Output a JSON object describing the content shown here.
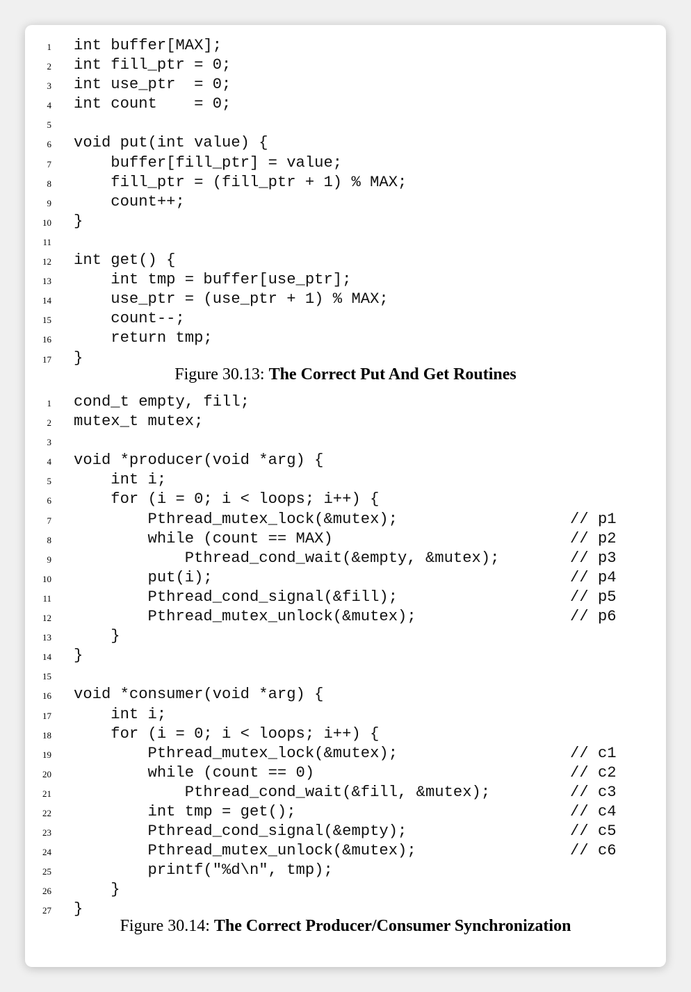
{
  "figure1": {
    "lines": [
      {
        "n": "1",
        "code": "int buffer[MAX];",
        "comment": ""
      },
      {
        "n": "2",
        "code": "int fill_ptr = 0;",
        "comment": ""
      },
      {
        "n": "3",
        "code": "int use_ptr  = 0;",
        "comment": ""
      },
      {
        "n": "4",
        "code": "int count    = 0;",
        "comment": ""
      },
      {
        "n": "5",
        "code": "",
        "comment": ""
      },
      {
        "n": "6",
        "code": "void put(int value) {",
        "comment": ""
      },
      {
        "n": "7",
        "code": "    buffer[fill_ptr] = value;",
        "comment": ""
      },
      {
        "n": "8",
        "code": "    fill_ptr = (fill_ptr + 1) % MAX;",
        "comment": ""
      },
      {
        "n": "9",
        "code": "    count++;",
        "comment": ""
      },
      {
        "n": "10",
        "code": "}",
        "comment": ""
      },
      {
        "n": "11",
        "code": "",
        "comment": ""
      },
      {
        "n": "12",
        "code": "int get() {",
        "comment": ""
      },
      {
        "n": "13",
        "code": "    int tmp = buffer[use_ptr];",
        "comment": ""
      },
      {
        "n": "14",
        "code": "    use_ptr = (use_ptr + 1) % MAX;",
        "comment": ""
      },
      {
        "n": "15",
        "code": "    count--;",
        "comment": ""
      },
      {
        "n": "16",
        "code": "    return tmp;",
        "comment": ""
      },
      {
        "n": "17",
        "code": "}",
        "comment": ""
      }
    ],
    "caption_number": "Figure 30.13:",
    "caption_title": "The Correct Put And Get Routines"
  },
  "figure2": {
    "lines": [
      {
        "n": "1",
        "code": "cond_t empty, fill;",
        "comment": ""
      },
      {
        "n": "2",
        "code": "mutex_t mutex;",
        "comment": ""
      },
      {
        "n": "3",
        "code": "",
        "comment": ""
      },
      {
        "n": "4",
        "code": "void *producer(void *arg) {",
        "comment": ""
      },
      {
        "n": "5",
        "code": "    int i;",
        "comment": ""
      },
      {
        "n": "6",
        "code": "    for (i = 0; i < loops; i++) {",
        "comment": ""
      },
      {
        "n": "7",
        "code": "        Pthread_mutex_lock(&mutex);",
        "comment": "// p1"
      },
      {
        "n": "8",
        "code": "        while (count == MAX)",
        "comment": "// p2"
      },
      {
        "n": "9",
        "code": "            Pthread_cond_wait(&empty, &mutex);",
        "comment": "// p3"
      },
      {
        "n": "10",
        "code": "        put(i);",
        "comment": "// p4"
      },
      {
        "n": "11",
        "code": "        Pthread_cond_signal(&fill);",
        "comment": "// p5"
      },
      {
        "n": "12",
        "code": "        Pthread_mutex_unlock(&mutex);",
        "comment": "// p6"
      },
      {
        "n": "13",
        "code": "    }",
        "comment": ""
      },
      {
        "n": "14",
        "code": "}",
        "comment": ""
      },
      {
        "n": "15",
        "code": "",
        "comment": ""
      },
      {
        "n": "16",
        "code": "void *consumer(void *arg) {",
        "comment": ""
      },
      {
        "n": "17",
        "code": "    int i;",
        "comment": ""
      },
      {
        "n": "18",
        "code": "    for (i = 0; i < loops; i++) {",
        "comment": ""
      },
      {
        "n": "19",
        "code": "        Pthread_mutex_lock(&mutex);",
        "comment": "// c1"
      },
      {
        "n": "20",
        "code": "        while (count == 0)",
        "comment": "// c2"
      },
      {
        "n": "21",
        "code": "            Pthread_cond_wait(&fill, &mutex);",
        "comment": "// c3"
      },
      {
        "n": "22",
        "code": "        int tmp = get();",
        "comment": "// c4"
      },
      {
        "n": "23",
        "code": "        Pthread_cond_signal(&empty);",
        "comment": "// c5"
      },
      {
        "n": "24",
        "code": "        Pthread_mutex_unlock(&mutex);",
        "comment": "// c6"
      },
      {
        "n": "25",
        "code": "        printf(\"%d\\n\", tmp);",
        "comment": ""
      },
      {
        "n": "26",
        "code": "    }",
        "comment": ""
      },
      {
        "n": "27",
        "code": "}",
        "comment": ""
      }
    ],
    "caption_number": "Figure 30.14:",
    "caption_title": "The Correct Producer/Consumer Synchronization"
  }
}
